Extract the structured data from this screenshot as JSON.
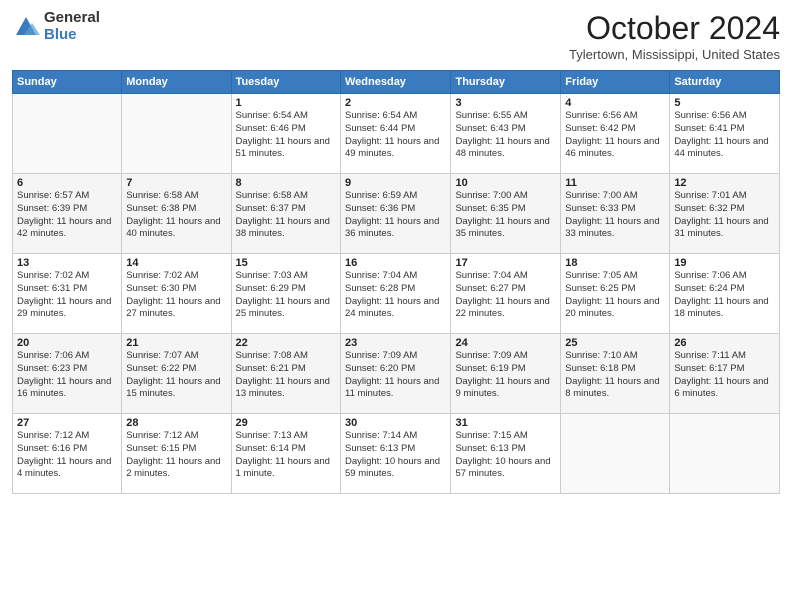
{
  "logo": {
    "general": "General",
    "blue": "Blue"
  },
  "title": "October 2024",
  "location": "Tylertown, Mississippi, United States",
  "days_header": [
    "Sunday",
    "Monday",
    "Tuesday",
    "Wednesday",
    "Thursday",
    "Friday",
    "Saturday"
  ],
  "weeks": [
    [
      {
        "num": "",
        "detail": ""
      },
      {
        "num": "",
        "detail": ""
      },
      {
        "num": "1",
        "detail": "Sunrise: 6:54 AM\nSunset: 6:46 PM\nDaylight: 11 hours and 51 minutes."
      },
      {
        "num": "2",
        "detail": "Sunrise: 6:54 AM\nSunset: 6:44 PM\nDaylight: 11 hours and 49 minutes."
      },
      {
        "num": "3",
        "detail": "Sunrise: 6:55 AM\nSunset: 6:43 PM\nDaylight: 11 hours and 48 minutes."
      },
      {
        "num": "4",
        "detail": "Sunrise: 6:56 AM\nSunset: 6:42 PM\nDaylight: 11 hours and 46 minutes."
      },
      {
        "num": "5",
        "detail": "Sunrise: 6:56 AM\nSunset: 6:41 PM\nDaylight: 11 hours and 44 minutes."
      }
    ],
    [
      {
        "num": "6",
        "detail": "Sunrise: 6:57 AM\nSunset: 6:39 PM\nDaylight: 11 hours and 42 minutes."
      },
      {
        "num": "7",
        "detail": "Sunrise: 6:58 AM\nSunset: 6:38 PM\nDaylight: 11 hours and 40 minutes."
      },
      {
        "num": "8",
        "detail": "Sunrise: 6:58 AM\nSunset: 6:37 PM\nDaylight: 11 hours and 38 minutes."
      },
      {
        "num": "9",
        "detail": "Sunrise: 6:59 AM\nSunset: 6:36 PM\nDaylight: 11 hours and 36 minutes."
      },
      {
        "num": "10",
        "detail": "Sunrise: 7:00 AM\nSunset: 6:35 PM\nDaylight: 11 hours and 35 minutes."
      },
      {
        "num": "11",
        "detail": "Sunrise: 7:00 AM\nSunset: 6:33 PM\nDaylight: 11 hours and 33 minutes."
      },
      {
        "num": "12",
        "detail": "Sunrise: 7:01 AM\nSunset: 6:32 PM\nDaylight: 11 hours and 31 minutes."
      }
    ],
    [
      {
        "num": "13",
        "detail": "Sunrise: 7:02 AM\nSunset: 6:31 PM\nDaylight: 11 hours and 29 minutes."
      },
      {
        "num": "14",
        "detail": "Sunrise: 7:02 AM\nSunset: 6:30 PM\nDaylight: 11 hours and 27 minutes."
      },
      {
        "num": "15",
        "detail": "Sunrise: 7:03 AM\nSunset: 6:29 PM\nDaylight: 11 hours and 25 minutes."
      },
      {
        "num": "16",
        "detail": "Sunrise: 7:04 AM\nSunset: 6:28 PM\nDaylight: 11 hours and 24 minutes."
      },
      {
        "num": "17",
        "detail": "Sunrise: 7:04 AM\nSunset: 6:27 PM\nDaylight: 11 hours and 22 minutes."
      },
      {
        "num": "18",
        "detail": "Sunrise: 7:05 AM\nSunset: 6:25 PM\nDaylight: 11 hours and 20 minutes."
      },
      {
        "num": "19",
        "detail": "Sunrise: 7:06 AM\nSunset: 6:24 PM\nDaylight: 11 hours and 18 minutes."
      }
    ],
    [
      {
        "num": "20",
        "detail": "Sunrise: 7:06 AM\nSunset: 6:23 PM\nDaylight: 11 hours and 16 minutes."
      },
      {
        "num": "21",
        "detail": "Sunrise: 7:07 AM\nSunset: 6:22 PM\nDaylight: 11 hours and 15 minutes."
      },
      {
        "num": "22",
        "detail": "Sunrise: 7:08 AM\nSunset: 6:21 PM\nDaylight: 11 hours and 13 minutes."
      },
      {
        "num": "23",
        "detail": "Sunrise: 7:09 AM\nSunset: 6:20 PM\nDaylight: 11 hours and 11 minutes."
      },
      {
        "num": "24",
        "detail": "Sunrise: 7:09 AM\nSunset: 6:19 PM\nDaylight: 11 hours and 9 minutes."
      },
      {
        "num": "25",
        "detail": "Sunrise: 7:10 AM\nSunset: 6:18 PM\nDaylight: 11 hours and 8 minutes."
      },
      {
        "num": "26",
        "detail": "Sunrise: 7:11 AM\nSunset: 6:17 PM\nDaylight: 11 hours and 6 minutes."
      }
    ],
    [
      {
        "num": "27",
        "detail": "Sunrise: 7:12 AM\nSunset: 6:16 PM\nDaylight: 11 hours and 4 minutes."
      },
      {
        "num": "28",
        "detail": "Sunrise: 7:12 AM\nSunset: 6:15 PM\nDaylight: 11 hours and 2 minutes."
      },
      {
        "num": "29",
        "detail": "Sunrise: 7:13 AM\nSunset: 6:14 PM\nDaylight: 11 hours and 1 minute."
      },
      {
        "num": "30",
        "detail": "Sunrise: 7:14 AM\nSunset: 6:13 PM\nDaylight: 10 hours and 59 minutes."
      },
      {
        "num": "31",
        "detail": "Sunrise: 7:15 AM\nSunset: 6:13 PM\nDaylight: 10 hours and 57 minutes."
      },
      {
        "num": "",
        "detail": ""
      },
      {
        "num": "",
        "detail": ""
      }
    ]
  ]
}
